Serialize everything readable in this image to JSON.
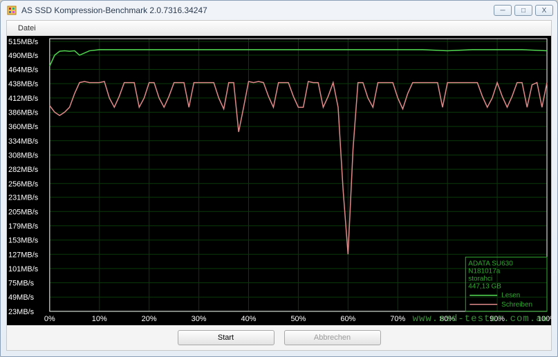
{
  "window": {
    "title": "AS SSD Kompression-Benchmark 2.0.7316.34247",
    "minimize": "─",
    "maximize": "□",
    "close": "X"
  },
  "menu": {
    "file": "Datei"
  },
  "buttons": {
    "start": "Start",
    "cancel": "Abbrechen"
  },
  "device": {
    "model": "ADATA SU630",
    "firmware": "N181017a",
    "driver": "storahci",
    "capacity": "447,13 GB"
  },
  "legend": {
    "read": "Lesen",
    "write": "Schreiben"
  },
  "watermark": "www.ssd-tester.com.au",
  "chart_data": {
    "type": "line",
    "title": "",
    "xlabel": "",
    "ylabel": "",
    "xlim": [
      0,
      100
    ],
    "ylim": [
      23,
      520
    ],
    "y_ticks": [
      515,
      490,
      464,
      438,
      412,
      386,
      360,
      334,
      308,
      282,
      256,
      231,
      205,
      179,
      153,
      127,
      101,
      75,
      49,
      23
    ],
    "y_tick_suffix": "MB/s",
    "x_ticks": [
      0,
      10,
      20,
      30,
      40,
      50,
      60,
      70,
      80,
      90,
      100
    ],
    "x_tick_suffix": "%",
    "series": [
      {
        "name": "Lesen",
        "color": "#4fd44f",
        "x": [
          0,
          1,
          2,
          3,
          4,
          5,
          6,
          8,
          10,
          15,
          20,
          25,
          30,
          35,
          40,
          45,
          50,
          55,
          60,
          65,
          70,
          75,
          80,
          85,
          90,
          95,
          100
        ],
        "y": [
          470,
          490,
          497,
          498,
          497,
          498,
          490,
          498,
          500,
          500,
          500,
          500,
          500,
          500,
          500,
          500,
          500,
          500,
          500,
          500,
          500,
          500,
          498,
          500,
          500,
          500,
          498
        ]
      },
      {
        "name": "Schreiben",
        "color": "#e08a8a",
        "x": [
          0,
          1,
          2,
          3,
          4,
          5,
          6,
          7,
          8,
          9,
          10,
          11,
          12,
          13,
          14,
          15,
          16,
          17,
          18,
          19,
          20,
          21,
          22,
          23,
          24,
          25,
          26,
          27,
          28,
          29,
          30,
          31,
          32,
          33,
          34,
          35,
          36,
          37,
          38,
          39,
          40,
          41,
          42,
          43,
          44,
          45,
          46,
          47,
          48,
          49,
          50,
          51,
          52,
          53,
          54,
          55,
          56,
          57,
          58,
          59,
          60,
          61,
          62,
          63,
          64,
          65,
          66,
          67,
          68,
          69,
          70,
          71,
          72,
          73,
          74,
          75,
          76,
          77,
          78,
          79,
          80,
          81,
          82,
          83,
          84,
          85,
          86,
          87,
          88,
          89,
          90,
          91,
          92,
          93,
          94,
          95,
          96,
          97,
          98,
          99,
          100
        ],
        "y": [
          398,
          386,
          380,
          386,
          395,
          420,
          440,
          442,
          440,
          440,
          440,
          442,
          412,
          395,
          415,
          440,
          440,
          440,
          395,
          412,
          440,
          440,
          412,
          395,
          415,
          440,
          440,
          440,
          395,
          440,
          440,
          440,
          440,
          440,
          412,
          392,
          440,
          440,
          350,
          395,
          442,
          440,
          442,
          440,
          415,
          395,
          440,
          440,
          440,
          415,
          395,
          395,
          442,
          440,
          440,
          395,
          415,
          440,
          395,
          245,
          127,
          318,
          440,
          440,
          412,
          395,
          440,
          440,
          440,
          440,
          412,
          392,
          420,
          440,
          440,
          440,
          440,
          440,
          440,
          395,
          440,
          440,
          440,
          440,
          440,
          440,
          440,
          415,
          395,
          412,
          440,
          415,
          395,
          415,
          440,
          440,
          395,
          436,
          440,
          395,
          440
        ]
      }
    ]
  }
}
